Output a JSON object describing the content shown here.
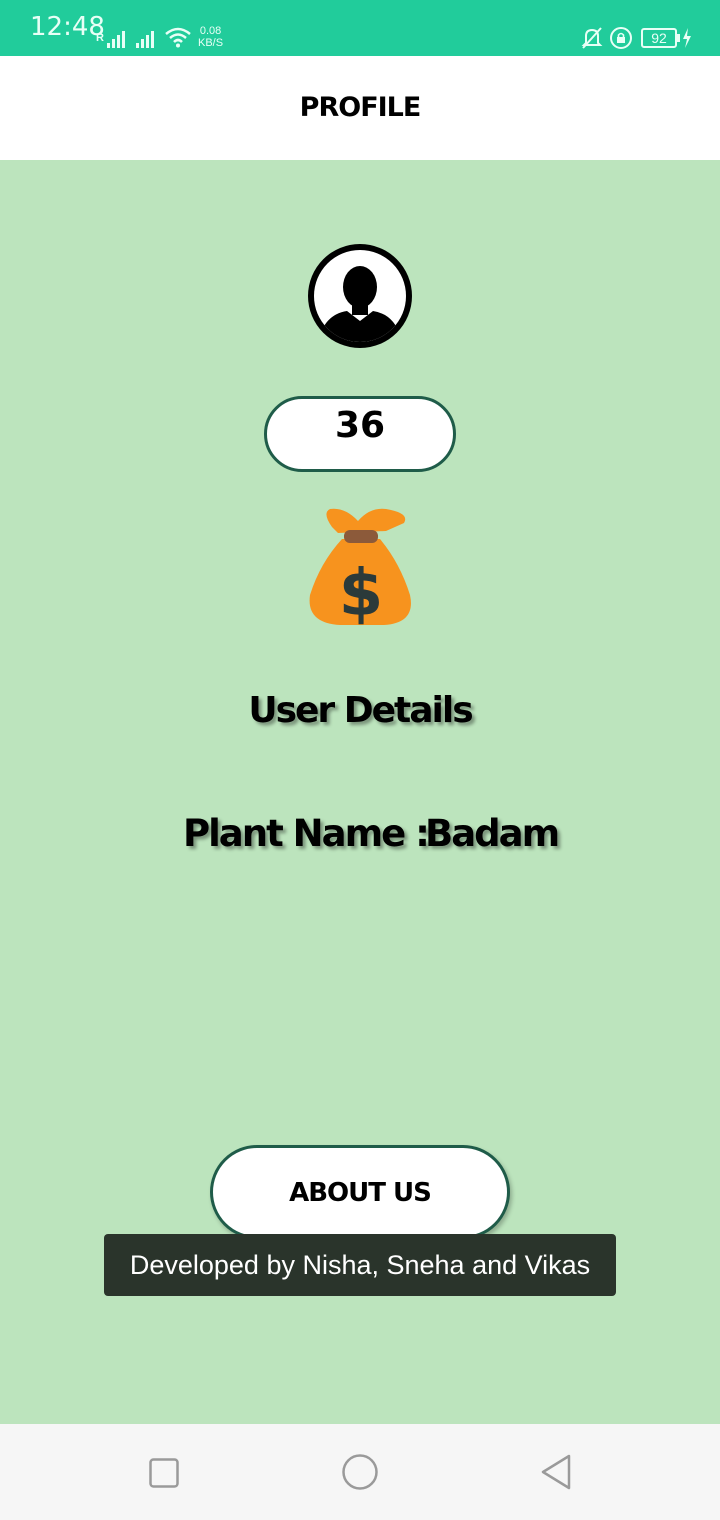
{
  "status_bar": {
    "time": "12:48",
    "roaming": "R",
    "net_speed_value": "0.08",
    "net_speed_unit": "KB/S",
    "battery": "92",
    "icons": [
      "signal-icon",
      "wifi-icon",
      "mute-bell-icon",
      "rotation-lock-icon",
      "battery-icon",
      "charging-icon"
    ]
  },
  "app_bar": {
    "title": "PROFILE"
  },
  "profile": {
    "avatar_icon": "user-avatar-icon",
    "score": "36",
    "coin_icon": "money-bag-icon",
    "section_title": "User Details",
    "plant_label": "Plant Name :",
    "plant_value": "Badam"
  },
  "about_button": {
    "label": "ABOUT US"
  },
  "toast": {
    "text": "Developed by Nisha, Sneha and Vikas"
  },
  "nav_bar": {
    "buttons": [
      "recents-square-icon",
      "home-circle-icon",
      "back-triangle-icon"
    ]
  },
  "colors": {
    "status_bar": "#21cc9b",
    "background": "#bce4bd",
    "accent_border": "#1f5c49",
    "toast_bg": "#2a342b",
    "money_bag": "#f7931e"
  }
}
